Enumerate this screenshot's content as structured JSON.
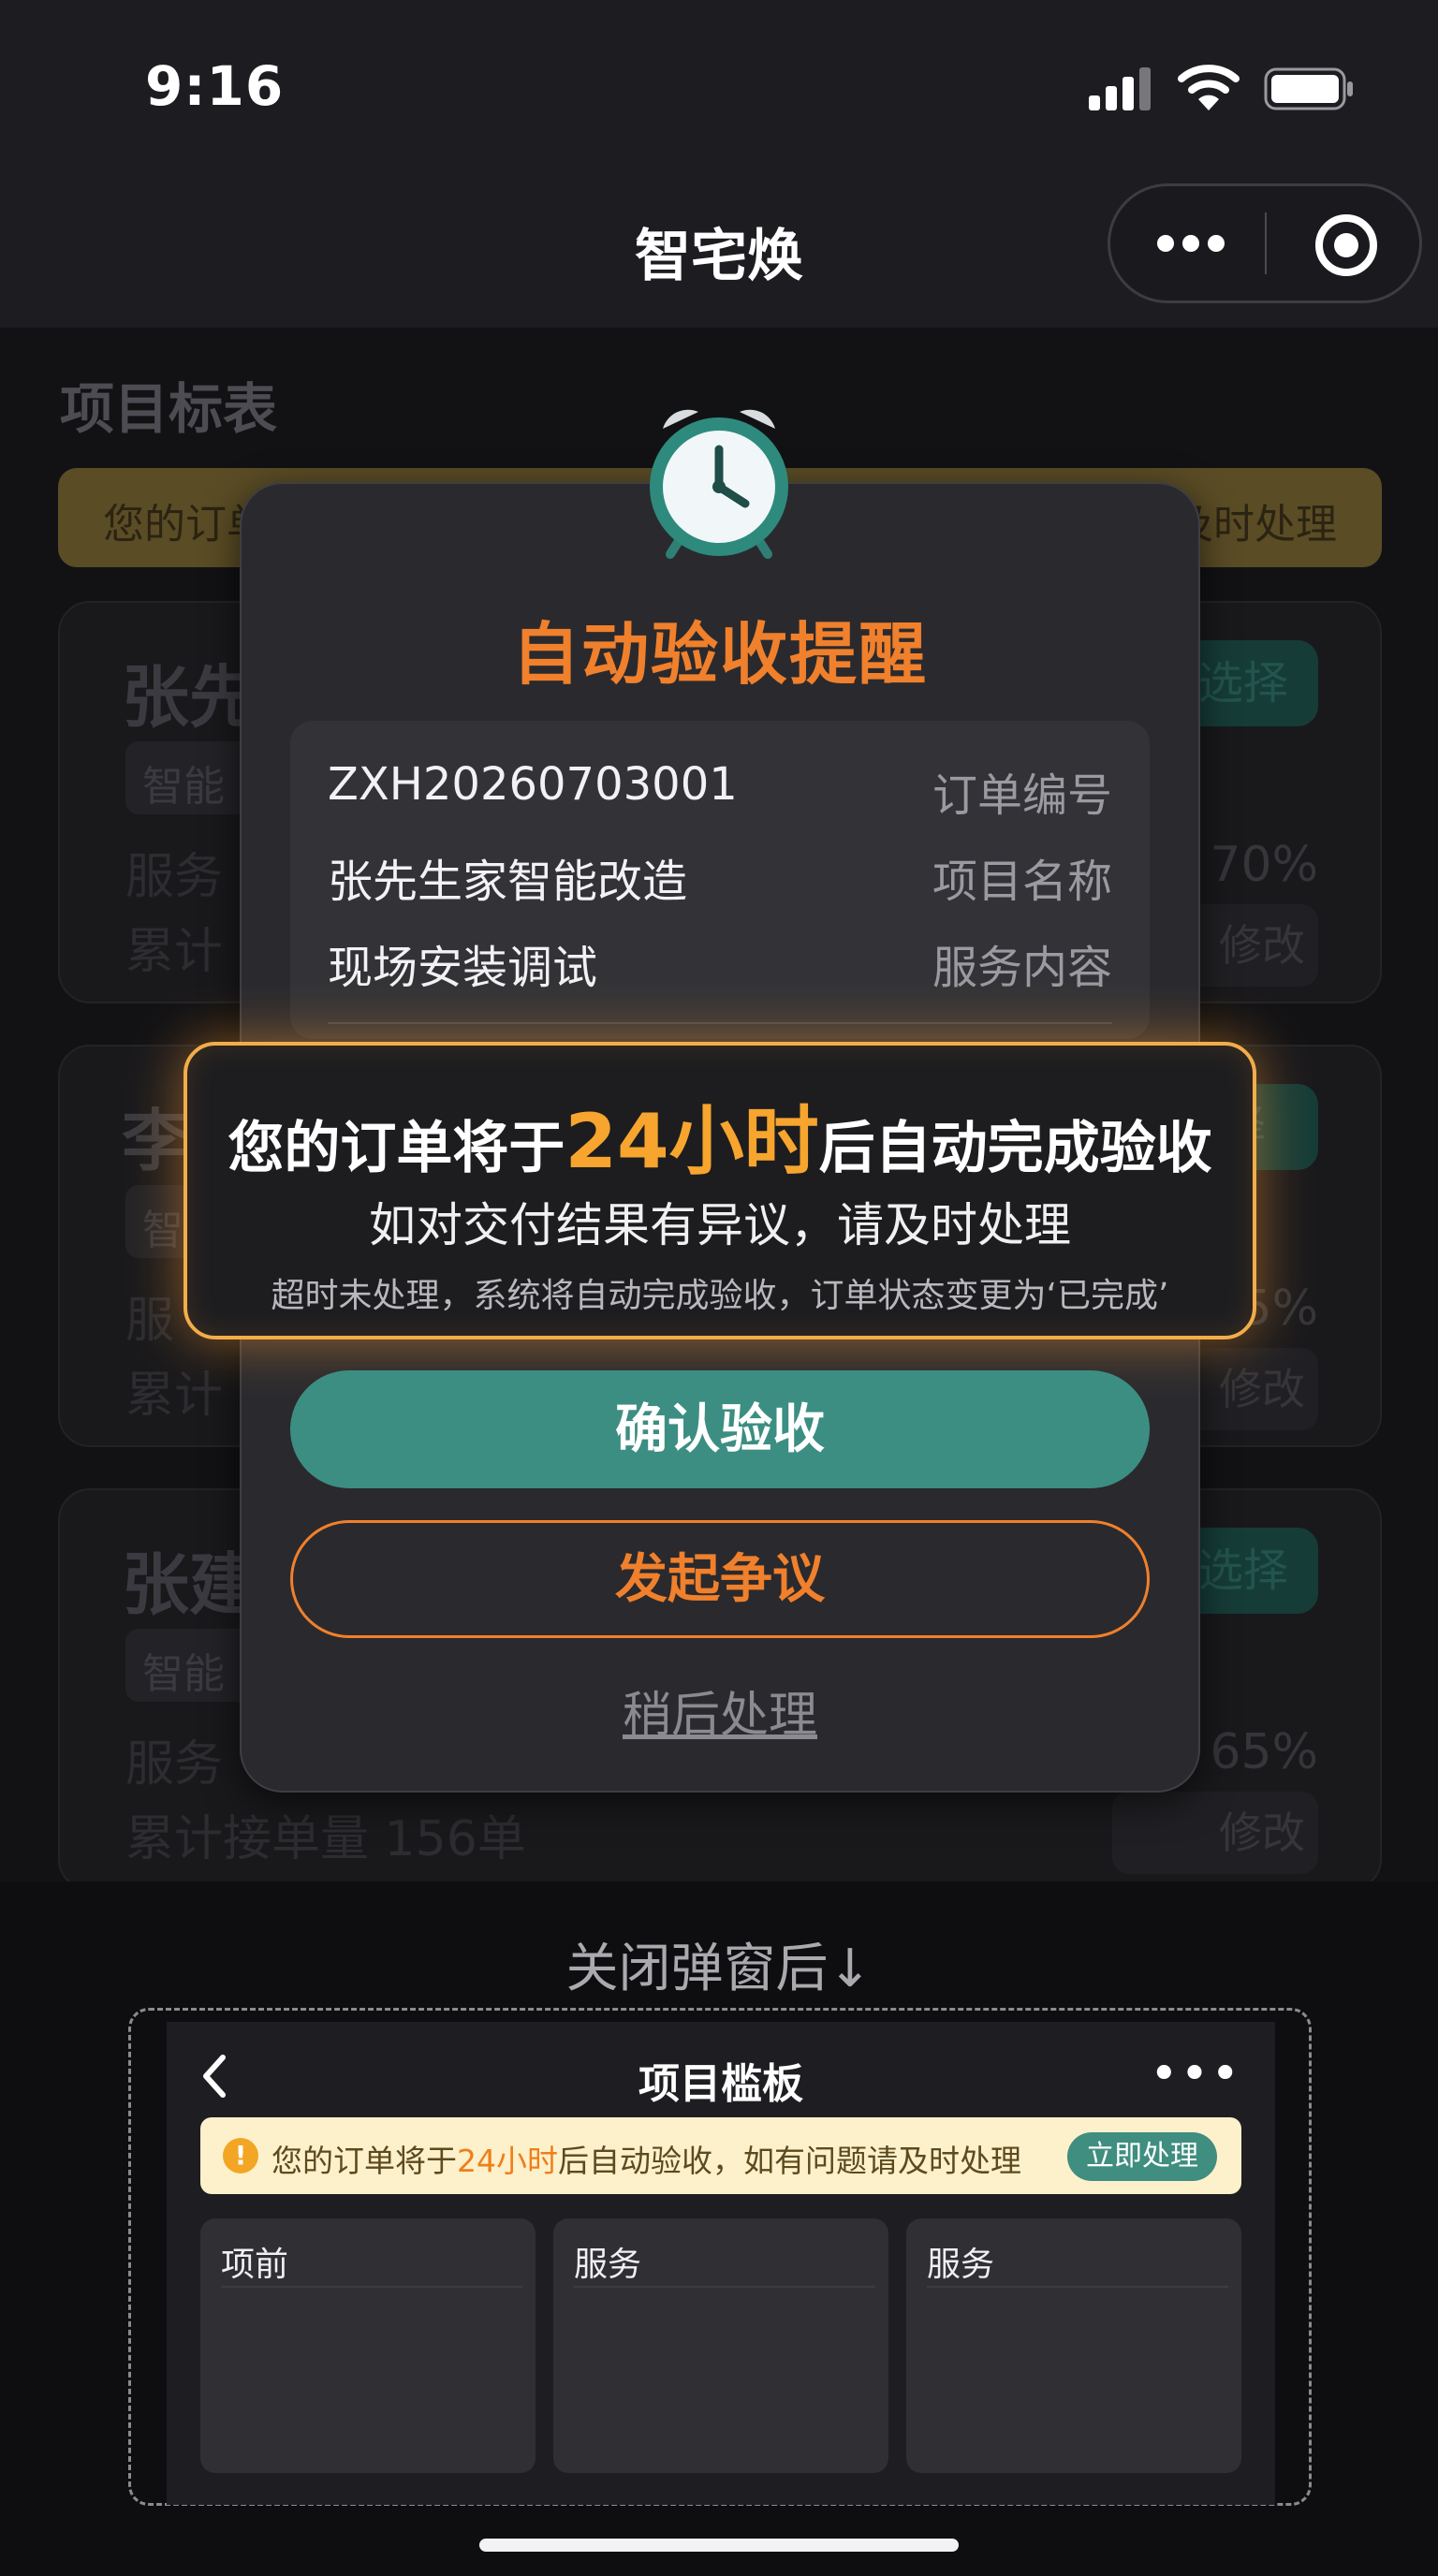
{
  "status_bar": {
    "time": "9:16"
  },
  "nav": {
    "title": "智宅焕",
    "more_icon": "more-dots-icon",
    "close_icon": "target-circle-icon"
  },
  "background_page": {
    "title": "项目标表",
    "notice_left": "您的订单",
    "notice_right": "及时处理",
    "cards": [
      {
        "name": "张先",
        "tag": "智能",
        "line1": "服务",
        "line2": "累计",
        "choose": "选择",
        "pct": "70%",
        "modify": "修改"
      },
      {
        "name": "李",
        "tag": "智",
        "line1": "服",
        "line2": "累计",
        "choose": "择",
        "pct": "5%",
        "modify": "修改"
      },
      {
        "name": "张建",
        "tag": "智能",
        "line1": "服务",
        "line2": "累计接单量 156单",
        "choose": "选择",
        "pct": "65%",
        "modify": "修改"
      }
    ]
  },
  "modal": {
    "icon": "alarm-clock-icon",
    "title": "自动验收提醒",
    "info": [
      {
        "value": "ZXH20260703001",
        "key": "订单编号"
      },
      {
        "value": "张先生家智能改造",
        "key": "项目名称"
      },
      {
        "value": "现场安装调试",
        "key": "服务内容"
      }
    ],
    "highlight": {
      "prefix": "您的订单将于",
      "emphasis": "24小时",
      "suffix": "后自动完成验收",
      "line2": "如对交付结果有异议，请及时处理",
      "line3": "超时未处理，系统将自动完成验收，订单状态变更为‘已完成’"
    },
    "confirm_label": "确认验收",
    "dispute_label": "发起争议",
    "later_label": "稍后处理"
  },
  "after_close": {
    "label": "关闭弹窗后↓",
    "preview": {
      "back_icon": "chevron-left-icon",
      "title": "项目槛板",
      "more": "•••",
      "notice_prefix": "您的订单将于",
      "notice_highlight": "24小时",
      "notice_suffix": "后自动验收，如有问题请及时处理",
      "notice_button": "立即处理",
      "columns": [
        "项前",
        "服务",
        "服务"
      ]
    }
  },
  "colors": {
    "accent_orange": "#f0802c",
    "accent_teal": "#3c8e82",
    "highlight_gold": "#f7a52e"
  }
}
